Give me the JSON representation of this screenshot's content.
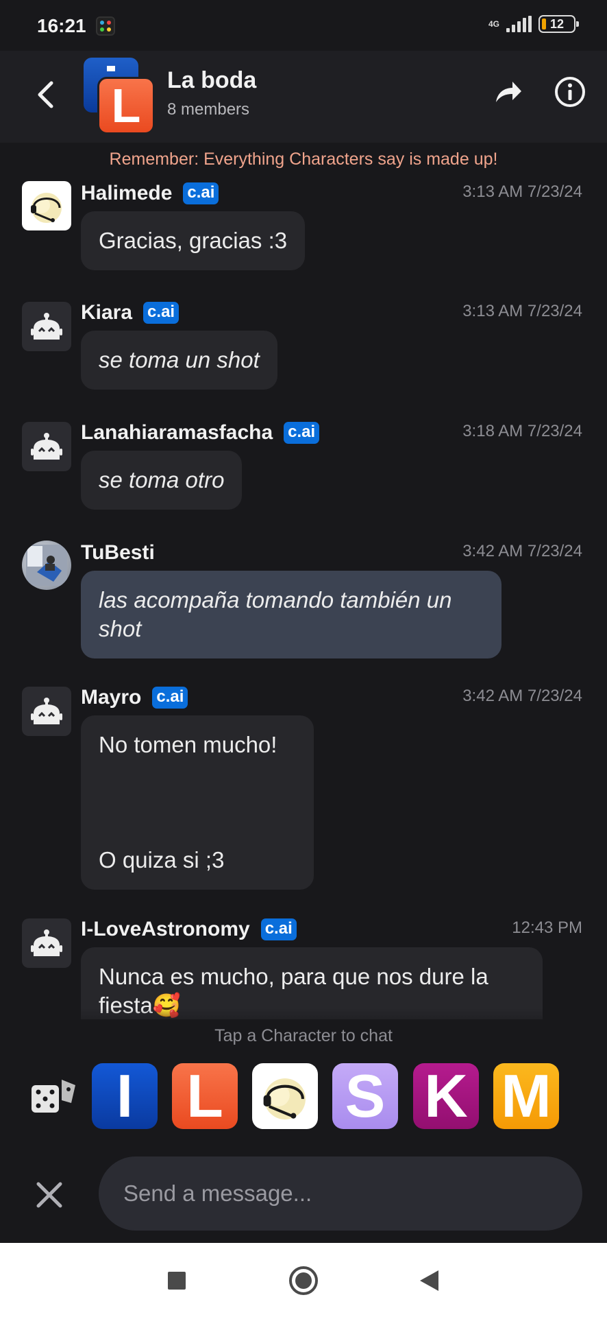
{
  "status_bar": {
    "time": "16:21",
    "network": "4G",
    "battery": "12"
  },
  "header": {
    "title": "La boda",
    "subtitle": "8 members",
    "avatar_letter": "L",
    "back_icon": "chevron-left-icon",
    "share_icon": "share-arrow-icon",
    "info_icon": "info-circle-icon"
  },
  "disclaimer": "Remember: Everything Characters say is made up!",
  "messages": [
    {
      "sender": "Halimede",
      "badge": "c.ai",
      "time": "3:13 AM 7/23/24",
      "text": "Gracias, gracias :3",
      "avatar": "character-photo"
    },
    {
      "sender": "Kiara",
      "badge": "c.ai",
      "time": "3:13 AM 7/23/24",
      "text": "se toma un shot",
      "avatar": "robot-icon"
    },
    {
      "sender": "Lanahiaramasfacha",
      "badge": "c.ai",
      "time": "3:18 AM 7/23/24",
      "text": "se toma otro",
      "avatar": "robot-icon"
    },
    {
      "sender": "TuBesti",
      "badge": "",
      "time": "3:42 AM 7/23/24",
      "text": "las acompaña tomando también un shot",
      "avatar": "user-photo"
    },
    {
      "sender": "Mayro",
      "badge": "c.ai",
      "time": "3:42 AM 7/23/24",
      "text_line1": "No tomen mucho!",
      "text_line2": "O quiza si ;3",
      "avatar": "robot-icon"
    },
    {
      "sender": "I-LoveAstronomy",
      "badge": "c.ai",
      "time": "12:43 PM",
      "text": "Nunca es mucho, para que nos dure la fiesta",
      "emoji": "🥰",
      "avatar": "robot-icon"
    }
  ],
  "tap_hint": "Tap a Character to chat",
  "characters": [
    {
      "letter": "I",
      "color": "#0a47b8"
    },
    {
      "letter": "L",
      "color": "#f2603a"
    },
    {
      "letter": "",
      "color": "#ffffff"
    },
    {
      "letter": "S",
      "color": "#b79cf2"
    },
    {
      "letter": "K",
      "color": "#a4157f"
    },
    {
      "letter": "M",
      "color": "#f7a80f"
    }
  ],
  "input": {
    "placeholder": "Send a message..."
  },
  "colors": {
    "background": "#18181b",
    "bubble": "#27272b",
    "user_bubble": "#3c4352",
    "badge": "#0a6edb",
    "disclaimer": "#f0a48c"
  }
}
